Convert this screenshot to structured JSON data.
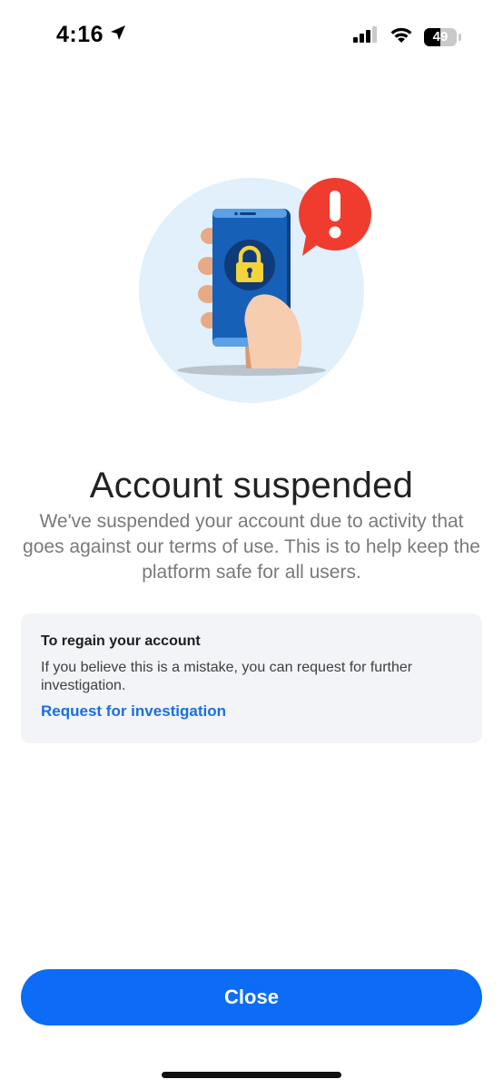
{
  "status_bar": {
    "time": "4:16",
    "battery_level": "49",
    "battery_fraction": 0.49,
    "icons": [
      "location-arrow-icon",
      "cellular-signal-icon",
      "wifi-icon",
      "battery-icon"
    ]
  },
  "illustration": {
    "icons": [
      "phone-icon",
      "lock-icon",
      "hand-icon",
      "alert-badge-icon"
    ],
    "colors": {
      "circle": "#e1f0fb",
      "phone": "#1760b7",
      "lock": "#f4d33b",
      "alert": "#f03c2e",
      "hand": "#f2c7a5"
    }
  },
  "main": {
    "title": "Account suspended",
    "description": "We've suspended your account due to activity that goes against our terms of use. This is to help keep the platform safe for all users."
  },
  "info_card": {
    "title": "To regain your account",
    "text": "If you believe this is a mistake, you can request for further investigation.",
    "link_label": "Request for investigation"
  },
  "footer": {
    "close_label": "Close"
  },
  "colors": {
    "accent": "#0c6cf5",
    "link": "#1a6fe0",
    "card_bg": "#f3f4f8"
  }
}
